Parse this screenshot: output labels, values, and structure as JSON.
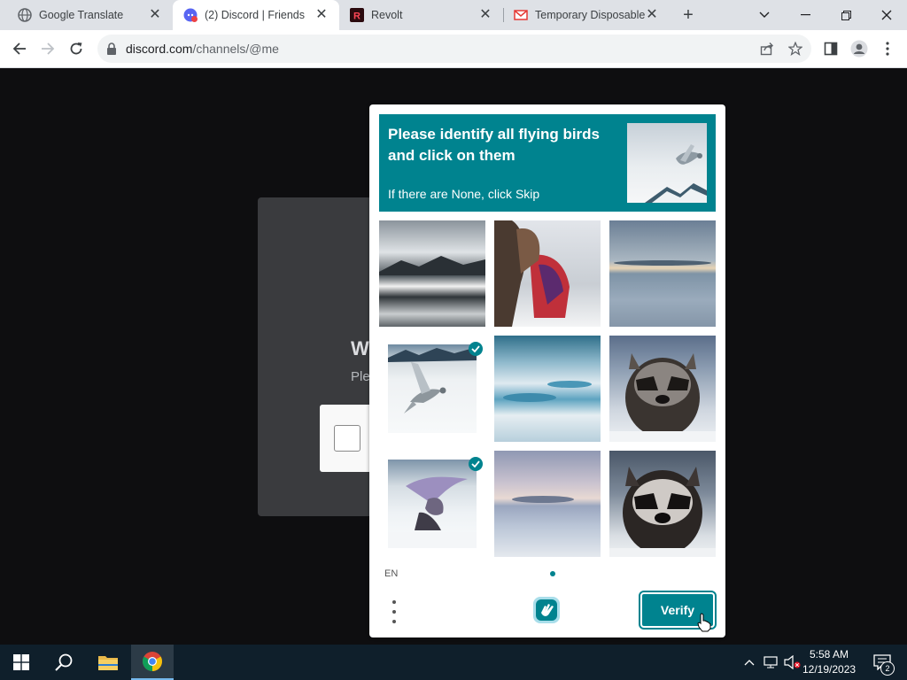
{
  "browser": {
    "tabs": [
      {
        "title": "Google Translate",
        "active": false
      },
      {
        "title": "(2) Discord | Friends",
        "active": true
      },
      {
        "title": "Revolt",
        "active": false
      },
      {
        "title": "Temporary Disposable",
        "active": false
      }
    ],
    "url_host": "discord.com",
    "url_path": "/channels/@me"
  },
  "discord": {
    "title_fragment": "W",
    "subtitle_fragment": "Ple"
  },
  "captcha": {
    "prompt_title": "Please identify all flying birds and click on them",
    "prompt_subtitle": "If there are None, click Skip",
    "language": "EN",
    "verify_label": "Verify",
    "tiles": [
      {
        "subject": "misty lake landscape",
        "selected": false
      },
      {
        "subject": "horse with red saddle in snow",
        "selected": false
      },
      {
        "subject": "frozen lake at dusk",
        "selected": false
      },
      {
        "subject": "bird flying over snow",
        "selected": true
      },
      {
        "subject": "icy snow waves",
        "selected": false
      },
      {
        "subject": "raccoon in snow",
        "selected": false
      },
      {
        "subject": "purple bird landing in snow",
        "selected": true
      },
      {
        "subject": "snowy plain at dusk",
        "selected": false
      },
      {
        "subject": "raccoon in snow",
        "selected": false
      }
    ]
  },
  "taskbar": {
    "time": "5:58 AM",
    "date": "12/19/2023",
    "notification_count": "2"
  },
  "colors": {
    "accent": "#00838f",
    "page_bg": "#0e0e10"
  }
}
